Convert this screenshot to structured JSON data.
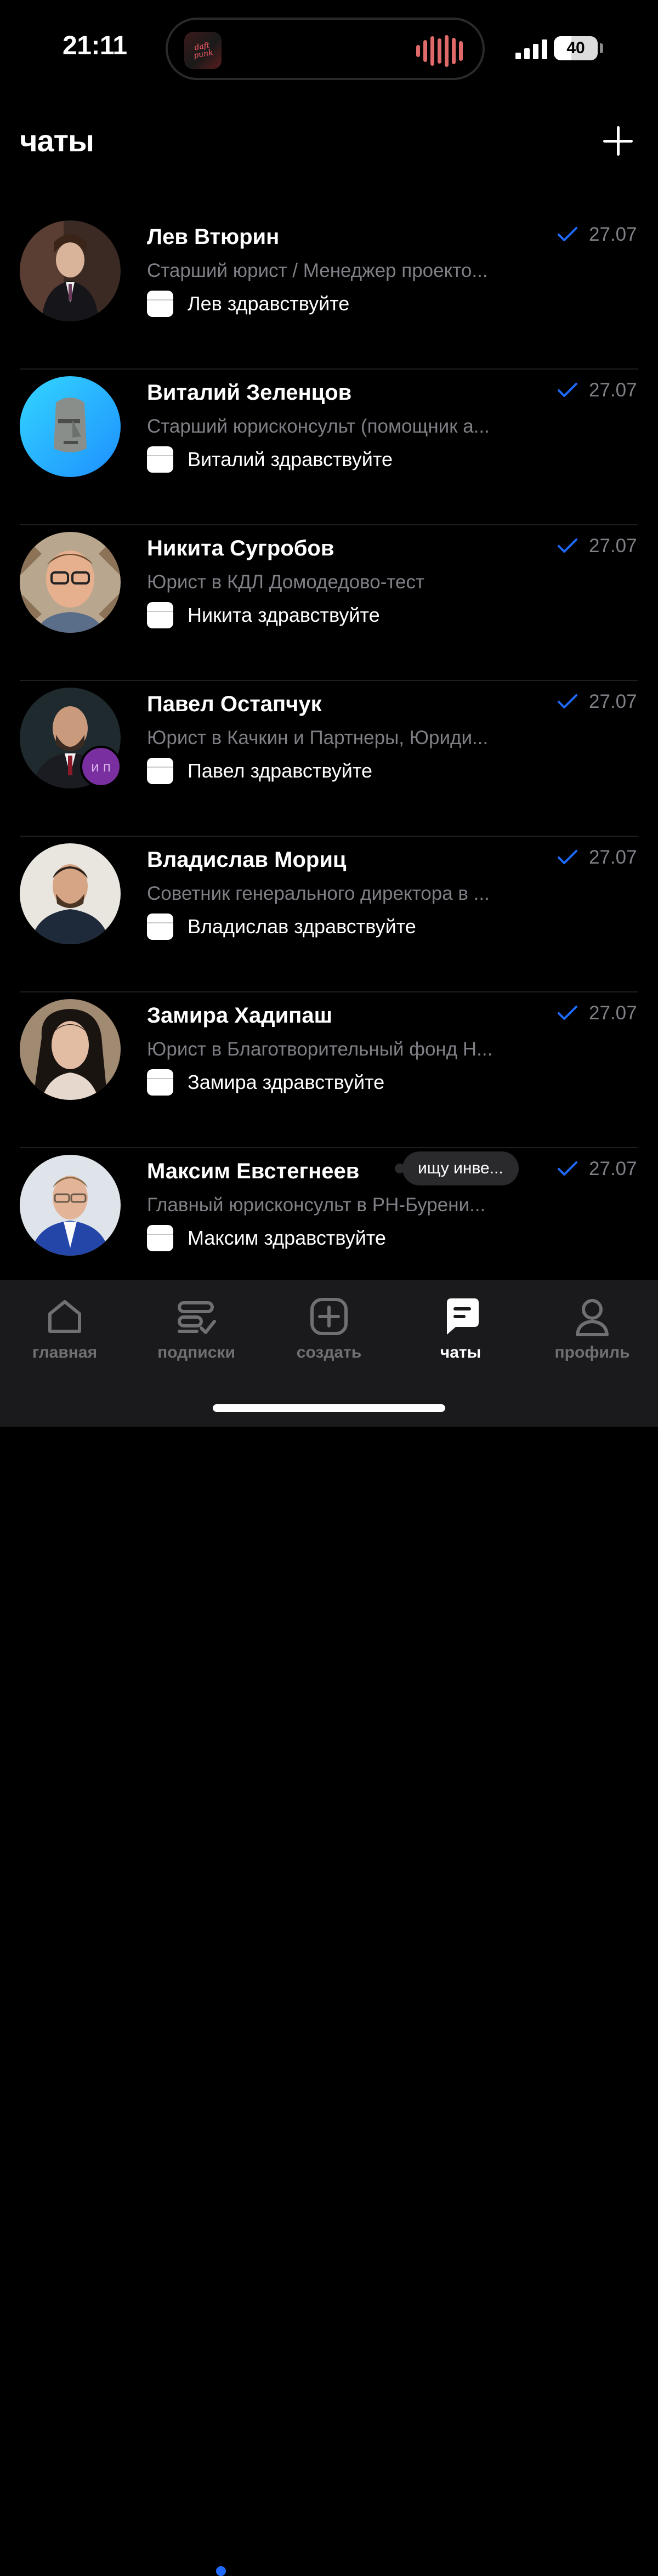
{
  "status_bar": {
    "time": "21:11",
    "battery": "40",
    "battery_level": 0.4,
    "island_art_text": "daft punk"
  },
  "header": {
    "title": "чаты"
  },
  "chats": [
    {
      "name": "Лев Втюрин",
      "subtitle": "Старший юрист / Менеджер проекто...",
      "message": "Лев здравствуйте",
      "date": "27.07"
    },
    {
      "name": "Виталий Зеленцов",
      "subtitle": "Старший юрисконсульт (помощник а...",
      "message": "Виталий здравствуйте",
      "date": "27.07"
    },
    {
      "name": "Никита Сугробов",
      "subtitle": "Юрист в КДЛ Домодедово-тест",
      "message": "Никита здравствуйте",
      "date": "27.07"
    },
    {
      "name": "Павел Остапчук",
      "subtitle": "Юрист в Качкин и Партнеры, Юриди...",
      "message": "Павел здравствуйте",
      "date": "27.07",
      "badge": "и п"
    },
    {
      "name": "Владислав Мориц",
      "subtitle": "Советник генерального директора в ...",
      "message": "Владислав здравствуйте",
      "date": "27.07"
    },
    {
      "name": "Замира Хадипаш",
      "subtitle": "Юрист в Благотворительный фонд Н...",
      "message": "Замира здравствуйте",
      "date": "27.07"
    },
    {
      "name": "Максим Евстегнеев",
      "subtitle": "Главный юрисконсульт в РН-Бурени...",
      "message": "Максим здравствуйте",
      "date": "27.07",
      "status_bubble": "ищу инве..."
    }
  ],
  "tabbar": {
    "items": [
      {
        "label": "главная",
        "icon": "home-icon"
      },
      {
        "label": "подписки",
        "icon": "subscriptions-icon",
        "has_dot": true
      },
      {
        "label": "создать",
        "icon": "create-icon"
      },
      {
        "label": "чаты",
        "icon": "chat-icon",
        "active": true
      },
      {
        "label": "профиль",
        "icon": "profile-icon"
      }
    ]
  },
  "colors": {
    "background": "#000000",
    "secondary_text": "#7f7f86",
    "accent_blue": "#1f6bff",
    "tabbar_bg": "#1a1a1c"
  }
}
